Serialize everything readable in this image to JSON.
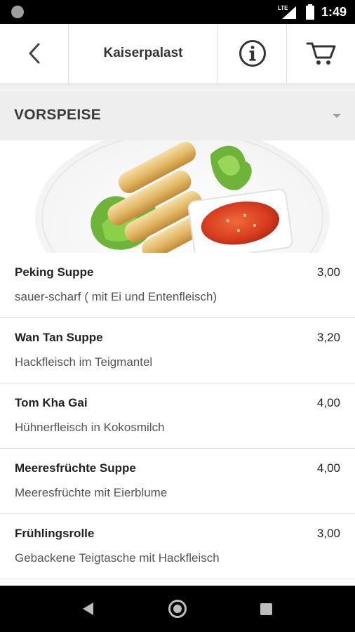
{
  "status_bar": {
    "network": "LTE",
    "time": "1:49"
  },
  "header": {
    "title": "Kaiserpalast",
    "icons": [
      "back-arrow-icon",
      "info-icon",
      "cart-icon"
    ]
  },
  "section": {
    "title": "VORSPEISE",
    "icon": "dropdown-arrow-icon"
  },
  "image": {
    "subject": "spring rolls with sweet chili dip"
  },
  "menu": {
    "items": [
      {
        "name": "Peking Suppe",
        "price": "3,00",
        "description": "sauer-scharf ( mit Ei und Entenfleisch)"
      },
      {
        "name": "Wan Tan Suppe",
        "price": "3,20",
        "description": "Hackfleisch im Teigmantel"
      },
      {
        "name": "Tom Kha Gai",
        "price": "4,00",
        "description": "Hühnerfleisch in Kokosmilch"
      },
      {
        "name": "Meeresfrüchte Suppe",
        "price": "4,00",
        "description": "Meeresfrüchte mit Eierblume"
      },
      {
        "name": "Frühlingsrolle",
        "price": "3,00",
        "description": "Gebackene Teigtasche mit Hackfleisch"
      }
    ]
  },
  "colors": {
    "section_bg": "#eeeeee",
    "divider": "#e0e0e0",
    "status_bar": "#000000"
  }
}
